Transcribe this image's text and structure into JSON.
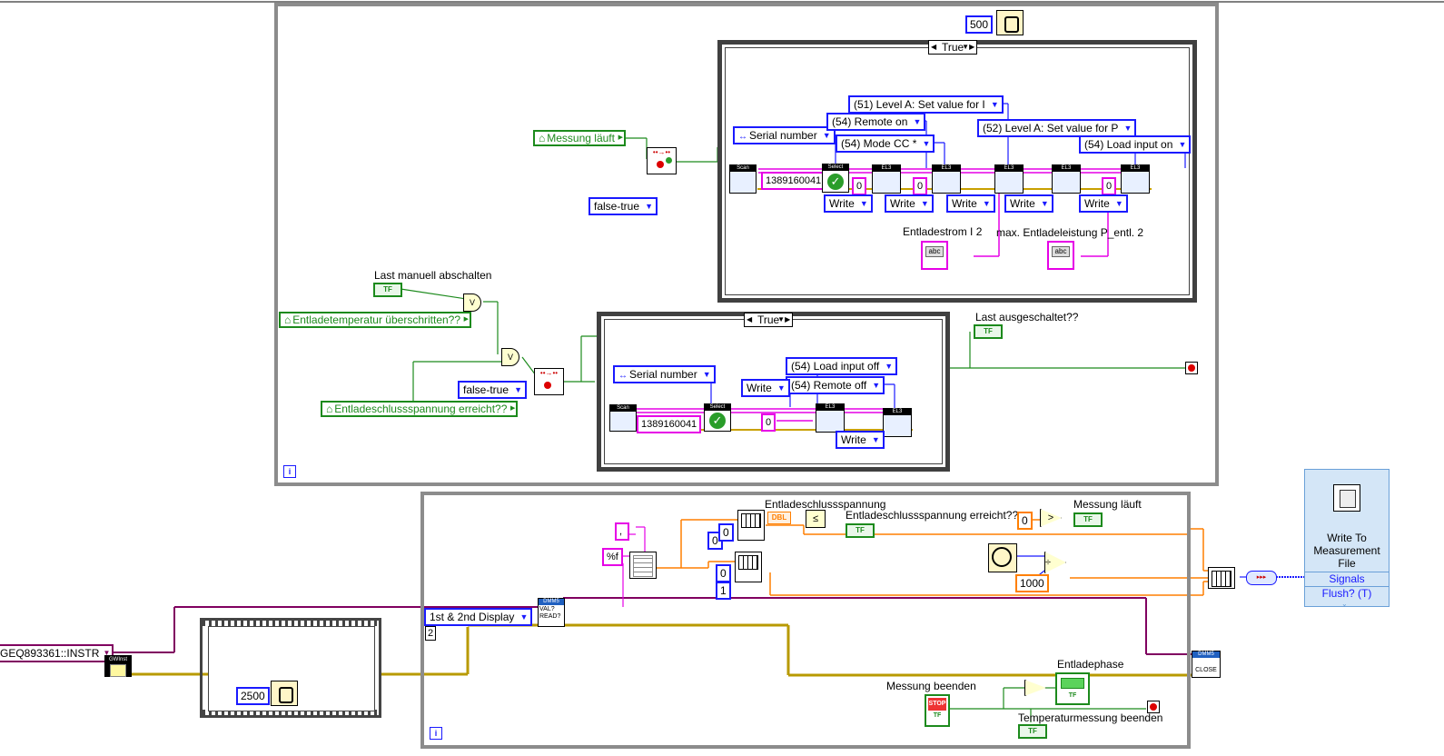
{
  "colors": {
    "int_wire": "#1a1aff",
    "bool_wire": "#1c8a1c",
    "dbl_wire": "#ff7f00",
    "str_wire": "#e600e6",
    "loop_border": "#8c8c8c",
    "visa_wire": "#800060"
  },
  "top_loop": {
    "wait_ms": "500",
    "iteration_terminal": "i",
    "case_top": {
      "selector": "True",
      "serial_ring": "Serial number",
      "serial_value": "1389160041",
      "scan_label": "Scan",
      "select_label": "Select",
      "el3_label": "EL3",
      "commands": [
        "(51) Level A: Set value for I",
        "(54) Remote on",
        "(54) Mode CC *",
        "(52) Level A: Set value for P",
        "(54) Load input on"
      ],
      "write_labels": [
        "Write",
        "Write",
        "Write",
        "Write",
        "Write"
      ],
      "zeros": [
        "0",
        "0",
        "0"
      ],
      "entladestrom_label": "Entladestrom I 2",
      "entladeleistung_label": "max. Entladeleistung P_entl.  2",
      "abc": "abc"
    },
    "messung_laeuft_local": "Messung läuft",
    "false_true_1": "false-true",
    "last_manuell_label": "Last manuell abschalten",
    "entladetemp_local": "Entladetemperatur überschritten??",
    "false_true_2": "false-true",
    "entladeschluss_local": "Entladeschlussspannung erreicht??",
    "case_bottom": {
      "selector": "True",
      "serial_ring": "Serial number",
      "serial_value": "1389160041",
      "scan_label": "Scan",
      "select_label": "Select",
      "el3_label": "EL3",
      "commands": [
        "(54) Load input off",
        "(54) Remote off"
      ],
      "write_labels": [
        "Write",
        "Write"
      ],
      "zero": "0"
    },
    "last_ausgeschaltet_label": "Last ausgeschaltet??",
    "tf": "TF",
    "or_symbol": "V"
  },
  "left": {
    "visa_resource": "GEQ893361::INSTR",
    "init_label": "GWInst",
    "wait_ms": "2500"
  },
  "bottom_loop": {
    "display_ring": "1st & 2nd Display",
    "display_const": "2",
    "dmm_label": "DMM5",
    "dmm_sub": "VAL?\nREAD?",
    "comma_const": ",",
    "format_const": "%f",
    "idx_zero_1": "0",
    "idx_zero_2": "0",
    "idx_one": "1",
    "dbl_label": "DBL",
    "entladeschlussspannung_label": "Entladeschlussspannung",
    "entladeschluss_erreicht_label": "Entladeschlussspannung erreicht??",
    "zero_orange": "0",
    "messung_laeuft_label": "Messung läuft",
    "thousand": "1000",
    "messung_beenden_label": "Messung beenden",
    "stop_label": "STOP",
    "entladephase_label": "Entladephase",
    "temperaturmessung_label": "Temperaturmessung beenden",
    "close_label": "CLOSE",
    "iteration_terminal": "i"
  },
  "express_vi": {
    "title_lines": [
      "Write To",
      "Measurement",
      "File"
    ],
    "inputs": [
      "Signals",
      "Flush? (T)"
    ]
  }
}
